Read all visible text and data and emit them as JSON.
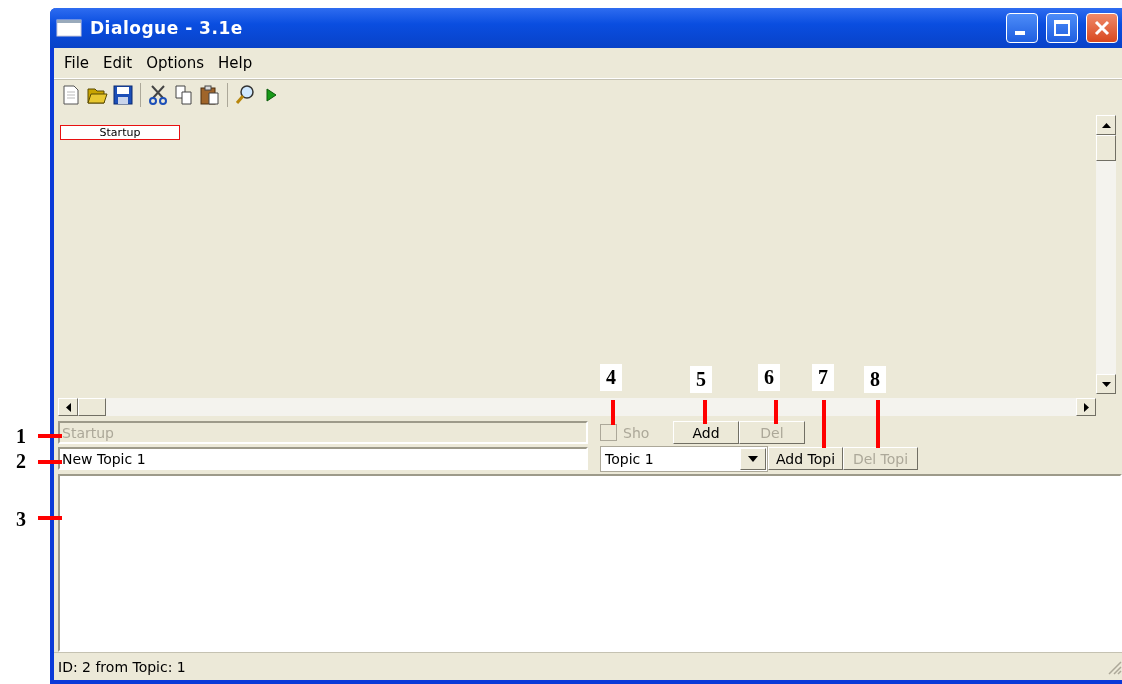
{
  "window": {
    "title": "Dialogue - 3.1e"
  },
  "menu": [
    "File",
    "Edit",
    "Options",
    "Help"
  ],
  "canvas": {
    "nodes": [
      {
        "label": "Startup",
        "selected": true
      }
    ]
  },
  "editor": {
    "node_text": {
      "value": "Startup",
      "disabled": true
    },
    "topic_name": {
      "value": "New Topic 1",
      "disabled": false
    },
    "show_checkbox": {
      "label": "Sho",
      "checked": false,
      "disabled": true
    },
    "buttons": [
      {
        "label": "Add",
        "disabled": false
      },
      {
        "label": "Del",
        "disabled": true
      }
    ],
    "topic_select": {
      "value": "Topic 1"
    },
    "topic_buttons": [
      {
        "label": "Add Topi",
        "disabled": false
      },
      {
        "label": "Del Topi",
        "disabled": true
      }
    ]
  },
  "status_bar": "ID: 2 from Topic: 1",
  "annotations": [
    "1",
    "2",
    "3",
    "4",
    "5",
    "6",
    "7",
    "8"
  ]
}
